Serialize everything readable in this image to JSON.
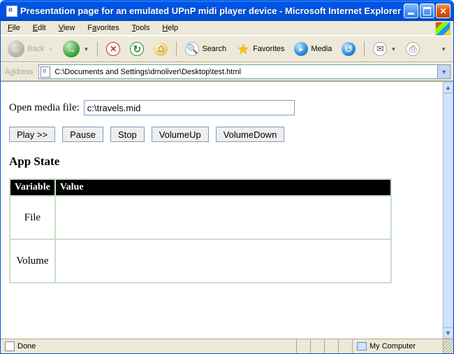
{
  "window": {
    "title": "Presentation page for an emulated UPnP midi player device - Microsoft Internet Explorer"
  },
  "menu": {
    "file": "File",
    "edit": "Edit",
    "view": "View",
    "favorites": "Favorites",
    "tools": "Tools",
    "help": "Help"
  },
  "toolbar": {
    "back": "Back",
    "search": "Search",
    "favorites": "Favorites",
    "media": "Media"
  },
  "address": {
    "label": "Address",
    "value": "C:\\Documents and Settings\\dmoliver\\Desktop\\test.html"
  },
  "page": {
    "open_label": "Open media file:",
    "open_value": "c:\\travels.mid",
    "buttons": {
      "play": "Play >>",
      "pause": "Pause",
      "stop": "Stop",
      "volup": "VolumeUp",
      "voldown": "VolumeDown"
    },
    "appstate_heading": "App State",
    "headers": {
      "variable": "Variable",
      "value": "Value"
    },
    "rows": [
      {
        "variable": "File",
        "value": ""
      },
      {
        "variable": "Volume",
        "value": ""
      }
    ]
  },
  "status": {
    "text": "Done",
    "zone": "My Computer"
  }
}
